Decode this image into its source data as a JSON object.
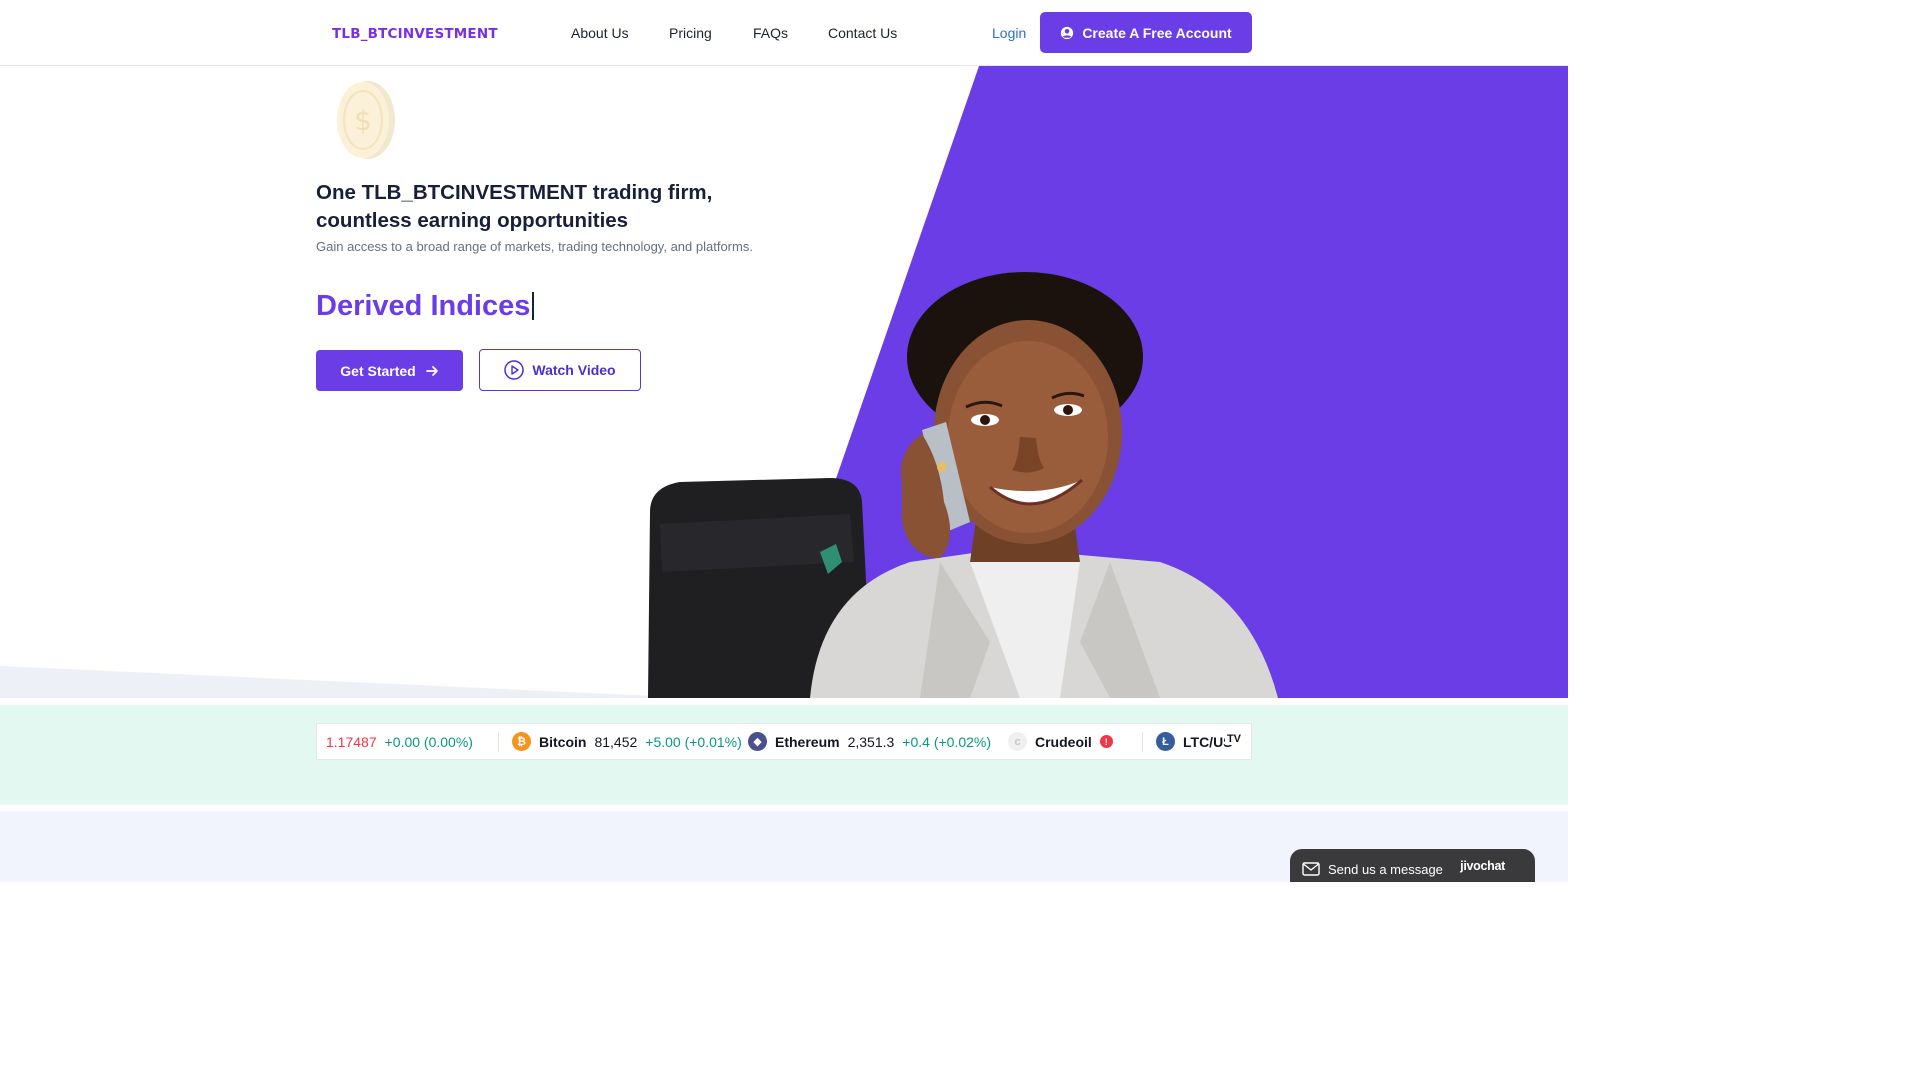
{
  "header": {
    "logo": "TLB_BTCINVESTMENT",
    "nav": [
      "About Us",
      "Pricing",
      "FAQs",
      "Contact Us"
    ],
    "login": "Login",
    "cta": "Create A Free Account"
  },
  "hero": {
    "headline_line1": "One TLB_BTCINVESTMENT trading firm,",
    "headline_line2": "countless earning opportunities",
    "subheadline": "Gain access to a broad range of markets, trading technology, and platforms.",
    "typed_text": "Derived Indices",
    "get_started": "Get Started",
    "watch_video": "Watch Video"
  },
  "ticker": {
    "items": [
      {
        "name": "",
        "price": "1.17487",
        "change": "+0.00 (0.00%)"
      },
      {
        "name": "Bitcoin",
        "price": "81,452",
        "change": "+5.00 (+0.01%)"
      },
      {
        "name": "Ethereum",
        "price": "2,351.3",
        "change": "+0.4 (+0.02%)"
      },
      {
        "name": "Crudeoil",
        "price": "",
        "change": ""
      },
      {
        "name": "LTC/US",
        "price": "",
        "change": ""
      }
    ],
    "provider_mark": "TV"
  },
  "chat": {
    "label": "Send us a message",
    "brand": "jivochat"
  },
  "colors": {
    "accent": "#6a3de6",
    "positive": "#089981",
    "negative": "#f23645",
    "ticker_band": "#e4f8f2"
  },
  "icons": [
    "user-circle-icon",
    "arrow-right-icon",
    "play-circle-icon",
    "bitcoin-icon",
    "ethereum-icon",
    "crudeoil-icon",
    "litecoin-icon",
    "mail-icon",
    "warning-icon"
  ]
}
